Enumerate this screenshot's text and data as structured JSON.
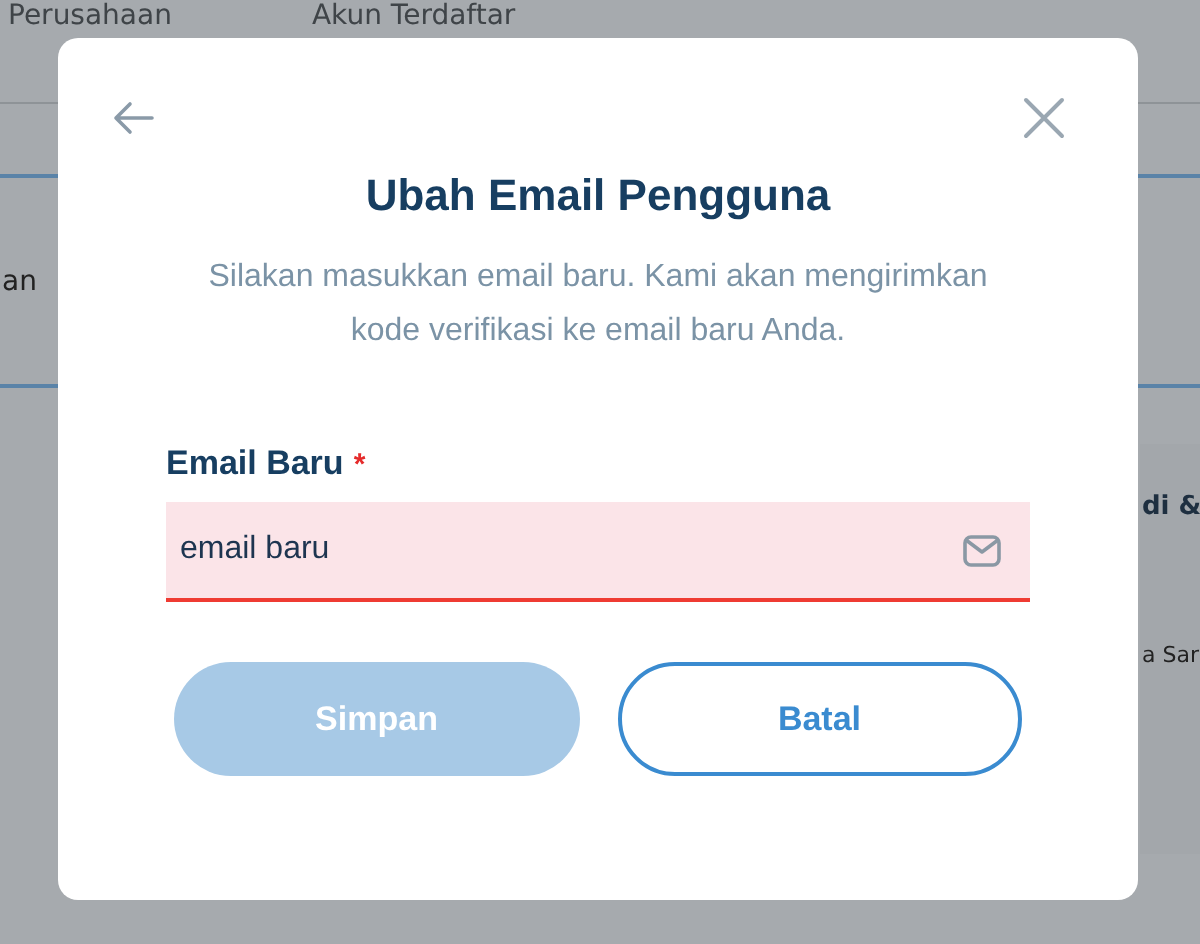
{
  "background": {
    "tabs": [
      "Perusahaan",
      "Akun Terdaftar"
    ],
    "row_text": "an",
    "side_card": {
      "title": "di &",
      "text": "a Sar"
    }
  },
  "dialog": {
    "title": "Ubah Email Pengguna",
    "description": "Silakan masukkan email baru. Kami akan mengirimkan kode verifikasi ke email baru Anda.",
    "field": {
      "label": "Email Baru",
      "required_mark": "*",
      "value": "email baru",
      "invalid": true
    },
    "buttons": [
      {
        "label": "Simpan",
        "kind": "primary",
        "disabled": true
      },
      {
        "label": "Batal",
        "kind": "secondary",
        "disabled": false
      }
    ]
  }
}
